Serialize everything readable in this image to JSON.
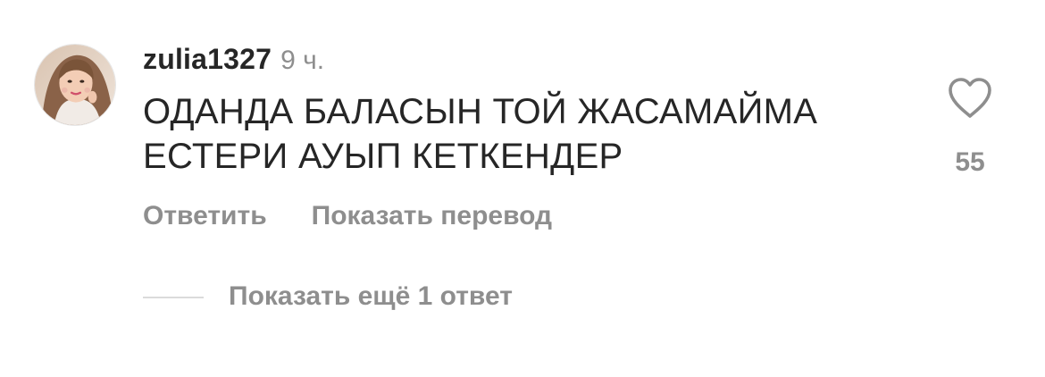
{
  "comment": {
    "username": "zulia1327",
    "time": "9 ч.",
    "text": "ОДАНДА БАЛАСЫН  ТОЙ  ЖАСАМАЙМА\nЕСТЕРИ  АУЫП  КЕТКЕНДЕР",
    "likes": "55",
    "like_icon": "heart-outline-icon"
  },
  "actions": {
    "reply_label": "Ответить",
    "translate_label": "Показать перевод"
  },
  "replies": {
    "show_more_label": "Показать ещё 1 ответ"
  },
  "colors": {
    "primary_text": "#262626",
    "secondary_text": "#8e8e8e",
    "divider": "#dbdbdb"
  }
}
